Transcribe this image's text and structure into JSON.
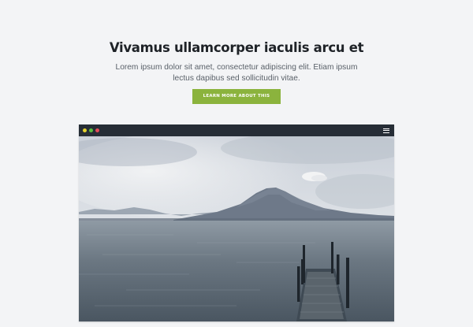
{
  "hero": {
    "title": "Vivamus ullamcorper iaculis arcu et",
    "text": "Lorem ipsum dolor sit amet, consectetur adipiscing elit. Etiam ipsum lectus dapibus sed sollicitudin vitae.",
    "button_label": "LEARN MORE ABOUT THIS"
  },
  "browser": {
    "dots": [
      {
        "name": "window-dot-yellow",
        "color": "#e5d12c"
      },
      {
        "name": "window-dot-green",
        "color": "#5bbf3c"
      },
      {
        "name": "window-dot-red",
        "color": "#e24c5a"
      }
    ],
    "menu_icon": "hamburger-menu-icon",
    "image_subject": "lake-pier-volcano"
  },
  "colors": {
    "background": "#f3f4f6",
    "accent": "#8bb33d",
    "title": "#1e2227",
    "browser_bar": "#262d36"
  }
}
